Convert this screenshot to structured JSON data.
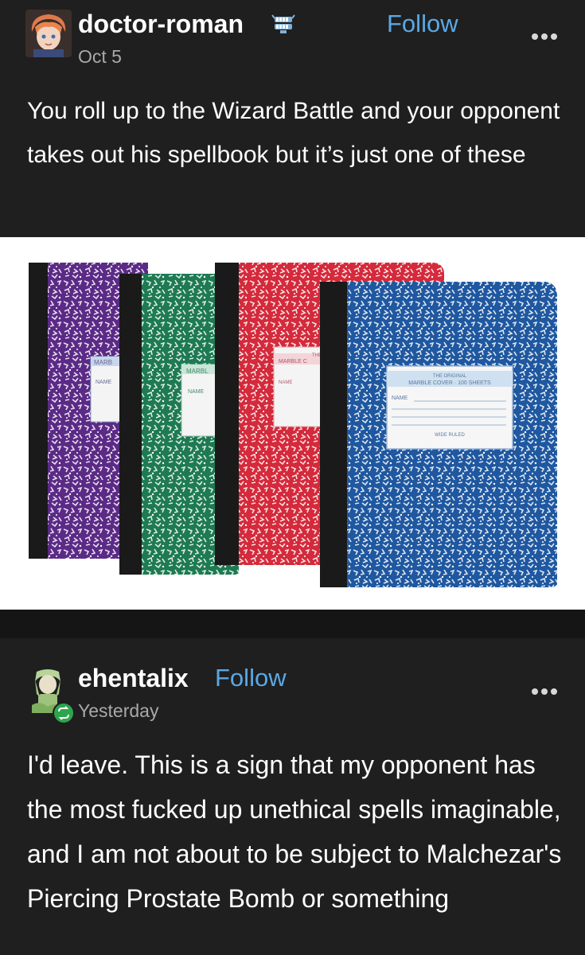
{
  "post1": {
    "username": "doctor-roman",
    "follow_label": "Follow",
    "date": "Oct 5",
    "text": "You roll up to the Wizard Battle and your opponent takes out his spellbook but it’s just one of these",
    "more_icon": "more-dots-icon",
    "badge_icon": "chattering-teeth-icon"
  },
  "notebook_labels": {
    "purple": {
      "title": "MARB",
      "name": "NAME"
    },
    "green": {
      "title": "MARBL",
      "name": "NAME"
    },
    "red": {
      "top": "THE",
      "title": "MARBLE C",
      "name": "NAME"
    },
    "blue": {
      "top": "THE ORIGINAL",
      "title": "MARBLE COVER · 100 SHEETS",
      "name": "NAME",
      "ruled": "WIDE RULED"
    }
  },
  "post2": {
    "username": "ehentalix",
    "follow_label": "Follow",
    "date": "Yesterday",
    "text": "I'd leave. This is a sign that my opponent has the most fucked up unethical spells imaginable, and I am not about to be subject to Malchezar's Piercing Prostate Bomb or something",
    "more_icon": "more-dots-icon",
    "reblog_icon": "reblog-icon"
  },
  "colors": {
    "background": "#1f1f1f",
    "follow": "#5aa8e6",
    "date": "#a9a9a9",
    "purple": "#5b2a86",
    "green": "#1e7a52",
    "red": "#d42a3b",
    "blue": "#1f58a0"
  }
}
